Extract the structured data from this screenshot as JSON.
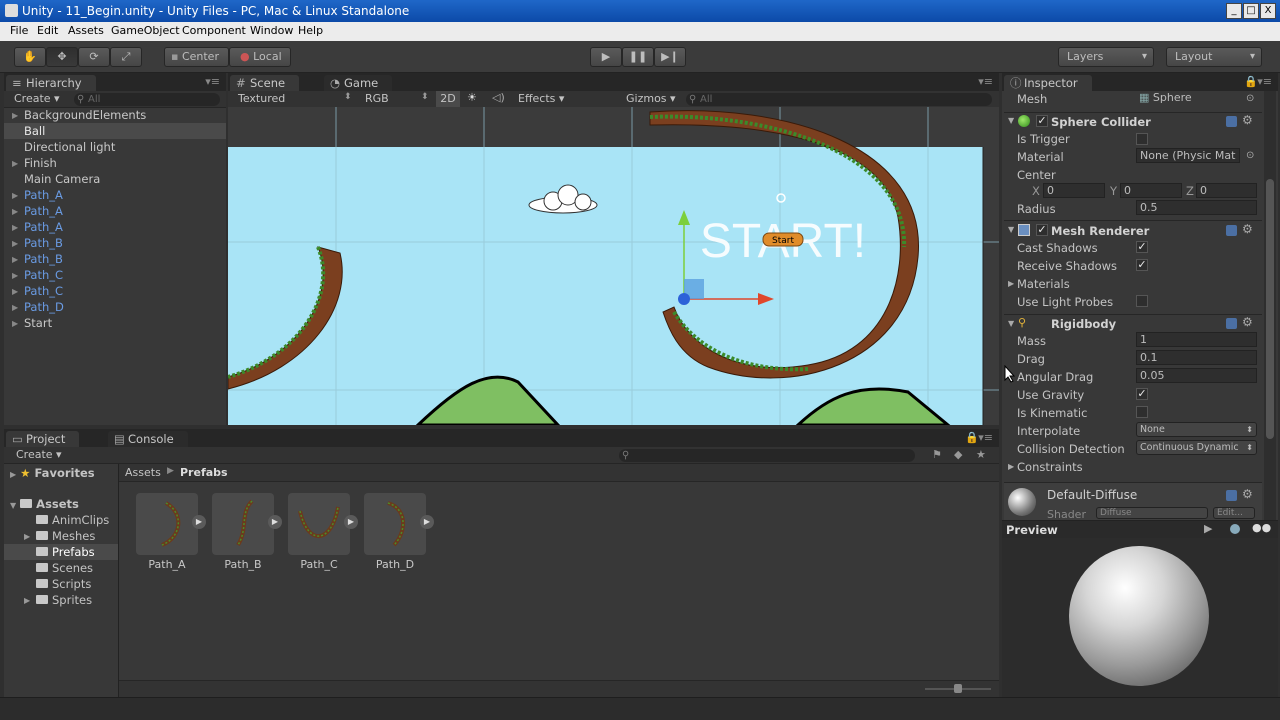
{
  "window": {
    "title": "Unity - 11_Begin.unity - Unity Files - PC, Mac & Linux Standalone",
    "minimize": "_",
    "maximize": "□",
    "close": "X"
  },
  "menu": [
    "File",
    "Edit",
    "Assets",
    "GameObject",
    "Component",
    "Window",
    "Help"
  ],
  "toolbar": {
    "pivot": "Center",
    "space": "Local",
    "layers": "Layers",
    "layout": "Layout"
  },
  "hierarchy": {
    "tab": "Hierarchy",
    "create": "Create",
    "search_placeholder": "All",
    "items": [
      {
        "label": "BackgroundElements",
        "expandable": true,
        "prefab": false
      },
      {
        "label": "Ball",
        "expandable": false,
        "prefab": false,
        "selected": true
      },
      {
        "label": "Directional light",
        "expandable": false,
        "prefab": false
      },
      {
        "label": "Finish",
        "expandable": true,
        "prefab": false
      },
      {
        "label": "Main Camera",
        "expandable": false,
        "prefab": false
      },
      {
        "label": "Path_A",
        "expandable": true,
        "prefab": true
      },
      {
        "label": "Path_A",
        "expandable": true,
        "prefab": true
      },
      {
        "label": "Path_A",
        "expandable": true,
        "prefab": true
      },
      {
        "label": "Path_B",
        "expandable": true,
        "prefab": true
      },
      {
        "label": "Path_B",
        "expandable": true,
        "prefab": true
      },
      {
        "label": "Path_C",
        "expandable": true,
        "prefab": true
      },
      {
        "label": "Path_C",
        "expandable": true,
        "prefab": true
      },
      {
        "label": "Path_D",
        "expandable": true,
        "prefab": true
      },
      {
        "label": "Start",
        "expandable": true,
        "prefab": false
      }
    ]
  },
  "scene": {
    "tab_scene": "Scene",
    "tab_game": "Game",
    "render_mode": "Textured",
    "color_mode": "RGB",
    "mode_2d": "2D",
    "effects": "Effects",
    "gizmos": "Gizmos",
    "search_placeholder": "All",
    "start_text": "START!",
    "start_badge": "Start"
  },
  "project": {
    "tab_project": "Project",
    "tab_console": "Console",
    "create": "Create",
    "favorites": "Favorites",
    "assets_root": "Assets",
    "folders": [
      "AnimClips",
      "Meshes",
      "Prefabs",
      "Scenes",
      "Scripts",
      "Sprites"
    ],
    "selected_folder": "Prefabs",
    "breadcrumb": [
      "Assets",
      "Prefabs"
    ],
    "assets": [
      "Path_A",
      "Path_B",
      "Path_C",
      "Path_D"
    ]
  },
  "inspector": {
    "tab": "Inspector",
    "mesh_label": "Mesh",
    "mesh_value": "Sphere",
    "sphere_collider": {
      "title": "Sphere Collider",
      "is_trigger": "Is Trigger",
      "is_trigger_value": false,
      "material": "Material",
      "material_value": "None (Physic Mat",
      "center": "Center",
      "center_x_label": "X",
      "center_x": "0",
      "center_y_label": "Y",
      "center_y": "0",
      "center_z_label": "Z",
      "center_z": "0",
      "radius": "Radius",
      "radius_value": "0.5"
    },
    "mesh_renderer": {
      "title": "Mesh Renderer",
      "cast_shadows": "Cast Shadows",
      "cast_shadows_value": true,
      "receive_shadows": "Receive Shadows",
      "receive_shadows_value": true,
      "materials": "Materials",
      "use_light_probes": "Use Light Probes",
      "use_light_probes_value": false
    },
    "rigidbody": {
      "title": "Rigidbody",
      "mass": "Mass",
      "mass_value": "1",
      "drag": "Drag",
      "drag_value": "0.1",
      "angular_drag": "Angular Drag",
      "angular_drag_value": "0.05",
      "use_gravity": "Use Gravity",
      "use_gravity_value": true,
      "is_kinematic": "Is Kinematic",
      "is_kinematic_value": false,
      "interpolate": "Interpolate",
      "interpolate_value": "None",
      "collision_detection": "Collision Detection",
      "collision_detection_value": "Continuous Dynamic",
      "constraints": "Constraints"
    },
    "material": {
      "name": "Default-Diffuse",
      "shader_label": "Shader",
      "shader_value": "Diffuse",
      "edit": "Edit..."
    },
    "preview": "Preview"
  }
}
